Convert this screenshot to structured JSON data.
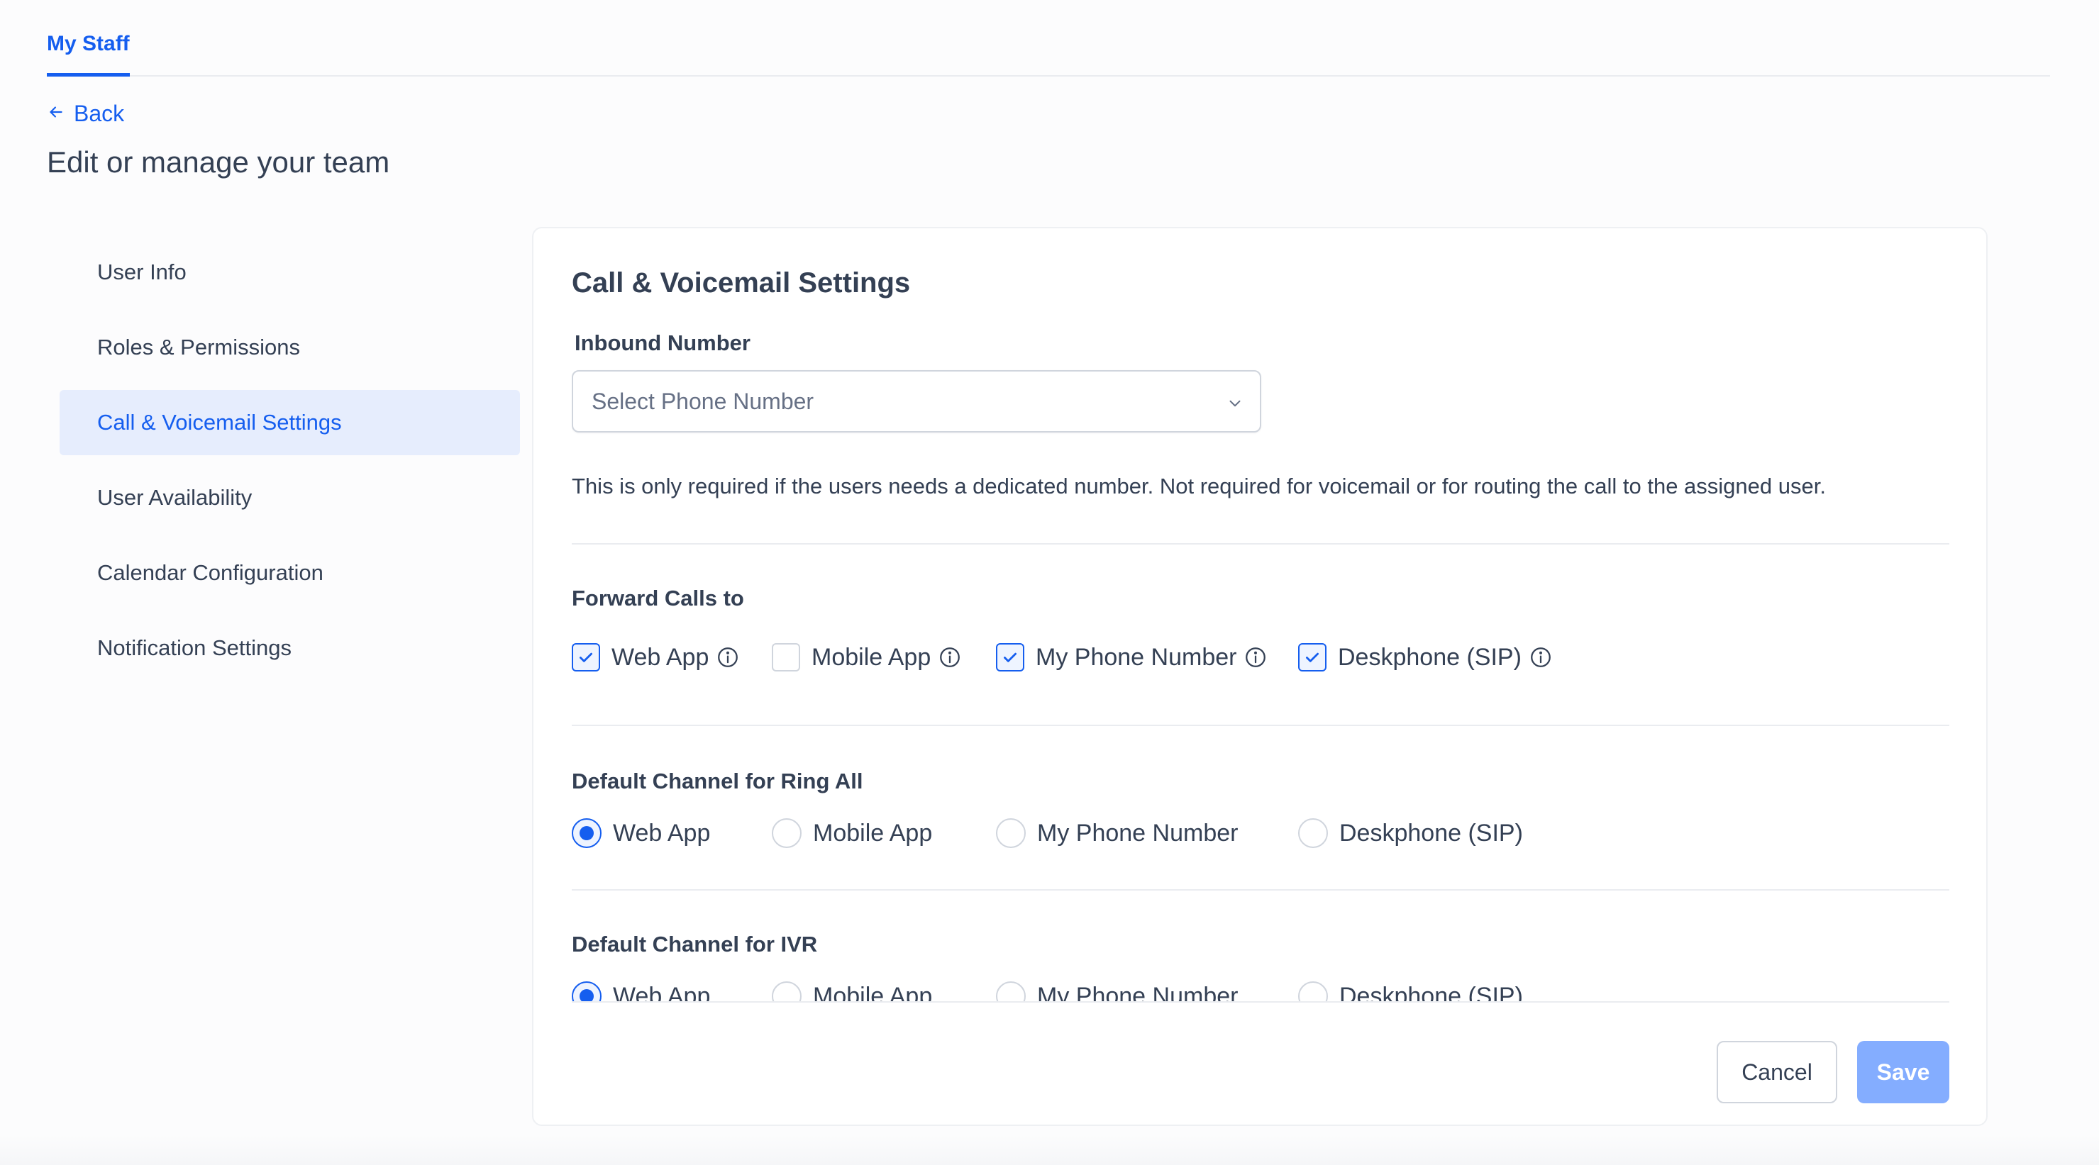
{
  "header": {
    "active_tab": "My Staff"
  },
  "back_label": "Back",
  "page_title": "Edit or manage your team",
  "sidebar": {
    "items": [
      {
        "label": "User Info",
        "active": false
      },
      {
        "label": "Roles & Permissions",
        "active": false
      },
      {
        "label": "Call & Voicemail Settings",
        "active": true
      },
      {
        "label": "User Availability",
        "active": false
      },
      {
        "label": "Calendar Configuration",
        "active": false
      },
      {
        "label": "Notification Settings",
        "active": false
      }
    ]
  },
  "panel": {
    "title": "Call & Voicemail Settings",
    "inbound": {
      "label": "Inbound Number",
      "placeholder": "Select Phone Number",
      "helper": "This is only required if the users needs a dedicated number. Not required for voicemail or for routing the call to the assigned user."
    },
    "forward": {
      "label": "Forward Calls to",
      "options": [
        {
          "label": "Web App",
          "checked": true
        },
        {
          "label": "Mobile App",
          "checked": false
        },
        {
          "label": "My Phone Number",
          "checked": true
        },
        {
          "label": "Deskphone (SIP)",
          "checked": true
        }
      ]
    },
    "ring_all": {
      "label": "Default Channel for Ring All",
      "options": [
        "Web App",
        "Mobile App",
        "My Phone Number",
        "Deskphone (SIP)"
      ],
      "selected": "Web App"
    },
    "ivr": {
      "label": "Default Channel for IVR",
      "options": [
        "Web App",
        "Mobile App",
        "My Phone Number",
        "Deskphone (SIP)"
      ],
      "selected": "Web App"
    }
  },
  "buttons": {
    "cancel": "Cancel",
    "save": "Save"
  },
  "colors": {
    "accent": "#155eef",
    "active_bg": "#e6edfd",
    "save_disabled": "#84adff"
  }
}
